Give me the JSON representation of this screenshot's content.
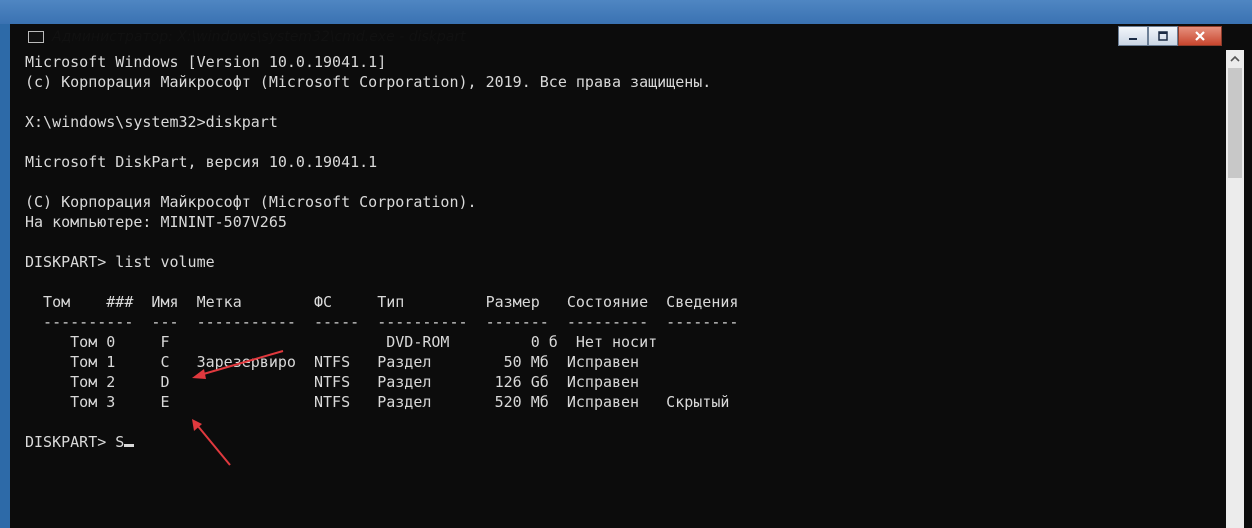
{
  "window": {
    "title": "Администратор: X:\\windows\\system32\\cmd.exe - diskpart",
    "controls": [
      "minimize-icon",
      "maximize-icon",
      "close-icon"
    ]
  },
  "console": {
    "header": [
      "Microsoft Windows [Version 10.0.19041.1]",
      "(c) Корпорация Майкрософт (Microsoft Corporation), 2019. Все права защищены."
    ],
    "prompt1": "X:\\windows\\system32>diskpart",
    "diskpart_version": "Microsoft DiskPart, версия 10.0.19041.1",
    "copyright": "(C) Корпорация Майкрософт (Microsoft Corporation).",
    "computer": "На компьютере: MININT-507V265",
    "prompt2": "DISKPART> list volume",
    "table_header": "  Том    ###  Имя  Метка        ФС     Тип         Размер   Состояние  Сведения",
    "table_separator": "  ----------  ---  -----------  -----  ----------  -------  ---------  --------",
    "table_rows": [
      "     Том 0     F                        DVD-ROM         0 б  Нет носит",
      "     Том 1     C   Зарезервиро  NTFS   Раздел        50 Мб  Исправен",
      "     Том 2     D                NTFS   Раздел       126 Gб  Исправен",
      "     Том 3     E                NTFS   Раздел       520 Мб  Исправен   Скрытый"
    ],
    "current_prompt": "DISKPART> S"
  },
  "colors": {
    "console_bg": "#0c0c0c",
    "console_fg": "#d9d9d9",
    "annotation_arrow": "#e0393e"
  }
}
